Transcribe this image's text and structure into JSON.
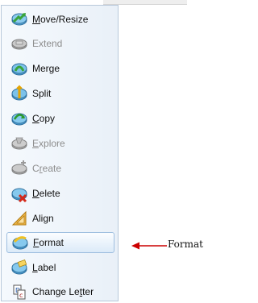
{
  "menu": {
    "items": [
      {
        "key": "move-resize",
        "before": "",
        "mnemonic": "M",
        "after": "ove/Resize",
        "enabled": true,
        "icon": "disk-move-resize-icon"
      },
      {
        "key": "extend",
        "before": "",
        "mnemonic": "",
        "after": "Extend",
        "enabled": false,
        "icon": "disk-extend-icon"
      },
      {
        "key": "merge",
        "before": "",
        "mnemonic": "",
        "after": "Merge",
        "enabled": true,
        "icon": "disk-merge-icon"
      },
      {
        "key": "split",
        "before": "",
        "mnemonic": "",
        "after": "Split",
        "enabled": true,
        "icon": "disk-split-icon"
      },
      {
        "key": "copy",
        "before": "",
        "mnemonic": "C",
        "after": "opy",
        "enabled": true,
        "icon": "disk-copy-icon"
      },
      {
        "key": "explore",
        "before": "",
        "mnemonic": "E",
        "after": "xplore",
        "enabled": false,
        "icon": "disk-explore-icon"
      },
      {
        "key": "create",
        "before": "C",
        "mnemonic": "r",
        "after": "eate",
        "enabled": false,
        "icon": "disk-create-icon"
      },
      {
        "key": "delete",
        "before": "",
        "mnemonic": "D",
        "after": "elete",
        "enabled": true,
        "icon": "disk-delete-icon"
      },
      {
        "key": "align",
        "before": "",
        "mnemonic": "",
        "after": "Align",
        "enabled": true,
        "icon": "align-ruler-icon"
      },
      {
        "key": "format",
        "before": "",
        "mnemonic": "F",
        "after": "ormat",
        "enabled": true,
        "selected": true,
        "icon": "disk-format-icon"
      },
      {
        "key": "label",
        "before": "",
        "mnemonic": "L",
        "after": "abel",
        "enabled": true,
        "icon": "disk-label-icon"
      },
      {
        "key": "change-letter",
        "before": "Change Le",
        "mnemonic": "t",
        "after": "ter",
        "enabled": true,
        "icon": "drive-letter-icon"
      }
    ]
  },
  "callout": {
    "label": "Format",
    "arrow_color": "#cc0000"
  },
  "colors": {
    "menu_bg": "#eef4fa",
    "menu_border": "#b8c8da",
    "selected_border": "#9fbfe0",
    "disabled_text": "#8d8d8d"
  }
}
